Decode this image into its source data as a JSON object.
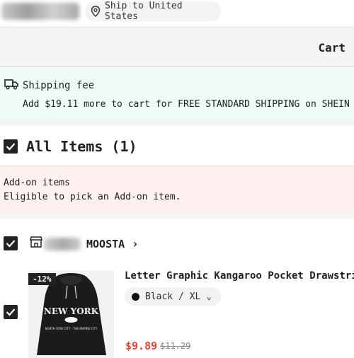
{
  "header": {
    "ship_to": "Ship to United States",
    "pin_icon": "location-pin-icon"
  },
  "cart": {
    "title": "Cart"
  },
  "shipping": {
    "icon": "truck-icon",
    "title": "Shipping fee",
    "message": "Add $19.11 more to cart for FREE STANDARD SHIPPING on SHEIN"
  },
  "all_items": {
    "label": "All Items (1)",
    "checked": true
  },
  "addon": {
    "title": "Add-on items",
    "subtitle": "Eligible to pick an Add-on item."
  },
  "store": {
    "name": "MOOSTA",
    "chevron": "›",
    "icon": "store-icon",
    "checked": true
  },
  "product": {
    "checked": true,
    "discount": "-12%",
    "title": "Letter Graphic Kangaroo Pocket Drawstring Hoodie",
    "variant": "Black / XL",
    "variant_chevron": "⌄",
    "price": "$9.89",
    "original_price": "$11.29",
    "print_main": "NEW YORK",
    "print_sub": "NORTH STAR CITY · THE EMPIRE CITY"
  },
  "colors": {
    "accent_red": "#e5482d",
    "shipping_bg": "#eefaf5",
    "addon_bg": "#fff1ef"
  }
}
